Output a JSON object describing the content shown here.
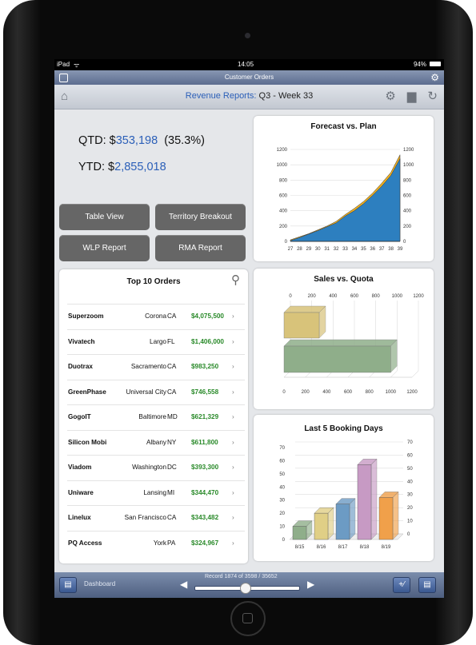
{
  "status": {
    "device": "iPad",
    "wifi_icon": "wifi-icon",
    "time": "14:05",
    "battery": "94%"
  },
  "app": {
    "title": "Customer Orders"
  },
  "nav": {
    "title_prefix": "Revenue Reports:",
    "title_suffix": " Q3 - Week 33"
  },
  "kpis": {
    "qtd_label": "QTD: $",
    "qtd_value": "353,198",
    "qtd_pct": "  (35.3%)",
    "ytd_label": "YTD: $",
    "ytd_value": "2,855,018"
  },
  "buttons": {
    "table_view": "Table View",
    "territory": "Territory Breakout",
    "wlp": "WLP Report",
    "rma": "RMA Report"
  },
  "orders": {
    "title": "Top 10 Orders",
    "rows": [
      {
        "name": "Superzoom",
        "city": "Corona",
        "state": "CA",
        "amount": "$4,075,500"
      },
      {
        "name": "Vivatech",
        "city": "Largo",
        "state": "FL",
        "amount": "$1,406,000"
      },
      {
        "name": "Duotrax",
        "city": "Sacramento",
        "state": "CA",
        "amount": "$983,250"
      },
      {
        "name": "GreenPhase",
        "city": "Universal City",
        "state": "CA",
        "amount": "$746,558"
      },
      {
        "name": "GogoIT",
        "city": "Baltimore",
        "state": "MD",
        "amount": "$621,329"
      },
      {
        "name": "Silicon Mobi",
        "city": "Albany",
        "state": "NY",
        "amount": "$611,800"
      },
      {
        "name": "Viadom",
        "city": "Washington",
        "state": "DC",
        "amount": "$393,300"
      },
      {
        "name": "Uniware",
        "city": "Lansing",
        "state": "MI",
        "amount": "$344,470"
      },
      {
        "name": "Linelux",
        "city": "San Francisco",
        "state": "CA",
        "amount": "$343,482"
      },
      {
        "name": "PQ Access",
        "city": "York",
        "state": "PA",
        "amount": "$324,967"
      }
    ]
  },
  "chart_data": [
    {
      "type": "area",
      "title": "Forecast vs. Plan",
      "categories": [
        "27",
        "28",
        "29",
        "30",
        "31",
        "32",
        "33",
        "34",
        "35",
        "36",
        "37",
        "38",
        "39"
      ],
      "series": [
        {
          "values": [
            20,
            60,
            100,
            150,
            200,
            260,
            350,
            430,
            520,
            630,
            760,
            900,
            1130
          ]
        },
        {
          "values": [
            10,
            50,
            95,
            140,
            190,
            240,
            330,
            400,
            490,
            600,
            720,
            860,
            1080
          ]
        }
      ],
      "ylim": [
        0,
        1200
      ],
      "yticks": [
        "0",
        "200",
        "400",
        "600",
        "800",
        "1000",
        "1200"
      ],
      "colors": [
        "#f0b020",
        "#2d7fbf"
      ]
    },
    {
      "type": "bar",
      "orientation": "horizontal",
      "title": "Sales vs. Quota",
      "values": [
        330,
        1000
      ],
      "xlim": [
        0,
        1200
      ],
      "xticks": [
        "0",
        "200",
        "400",
        "600",
        "800",
        "1000",
        "1200"
      ],
      "colors": [
        "#d8c37a",
        "#8fae8a"
      ]
    },
    {
      "type": "bar",
      "title": "Last 5 Booking Days",
      "categories": [
        "8/15",
        "8/16",
        "8/17",
        "8/18",
        "8/19"
      ],
      "values": [
        10,
        20,
        27,
        57,
        32
      ],
      "ylim": [
        0,
        70
      ],
      "yticks": [
        "0",
        "10",
        "20",
        "30",
        "40",
        "50",
        "60",
        "70"
      ],
      "colors": [
        "#8fae8a",
        "#e0cf86",
        "#6c9bc4",
        "#c79ac4",
        "#f0a04a"
      ]
    }
  ],
  "toolbar": {
    "dashboard": "Dashboard",
    "record": "Record 1874 of 3598 / 35652",
    "slider_position": 0.48
  }
}
